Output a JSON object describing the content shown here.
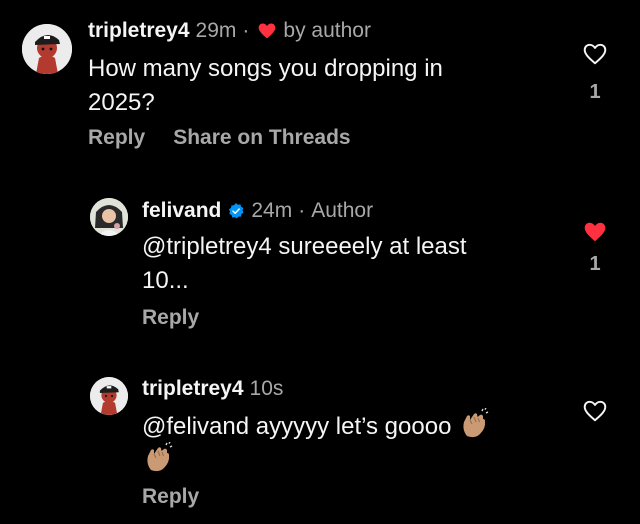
{
  "comments": [
    {
      "username": "tripletrey4",
      "time": "29m",
      "author_note": "by author",
      "text": "How many songs you dropping in 2025?",
      "line1": "How many songs you dropping in",
      "line2": "2025?",
      "reply_label": "Reply",
      "share_label": "Share on Threads",
      "likes": "1",
      "liked": false
    },
    {
      "username": "felivand",
      "time": "24m",
      "author_note": "Author",
      "verified": true,
      "text": "@tripletrey4 sureeeely at least 10...",
      "line1": "@tripletrey4 sureeeely at least",
      "line2": "10...",
      "reply_label": "Reply",
      "likes": "1",
      "liked": true
    },
    {
      "username": "tripletrey4",
      "time": "10s",
      "text": "@felivand ayyyyy let’s goooo 👏🏽👏🏽",
      "line1": "@felivand ayyyyy let’s goooo",
      "reply_label": "Reply",
      "liked": false
    }
  ],
  "colors": {
    "background": "#000000",
    "text": "#f5f5f5",
    "muted": "#a8a8a8",
    "like_red": "#ff3040",
    "verified_blue": "#0095f6"
  },
  "icons": [
    "heart-outline-icon",
    "heart-filled-icon",
    "verified-badge-icon",
    "clapping-hands-emoji"
  ]
}
